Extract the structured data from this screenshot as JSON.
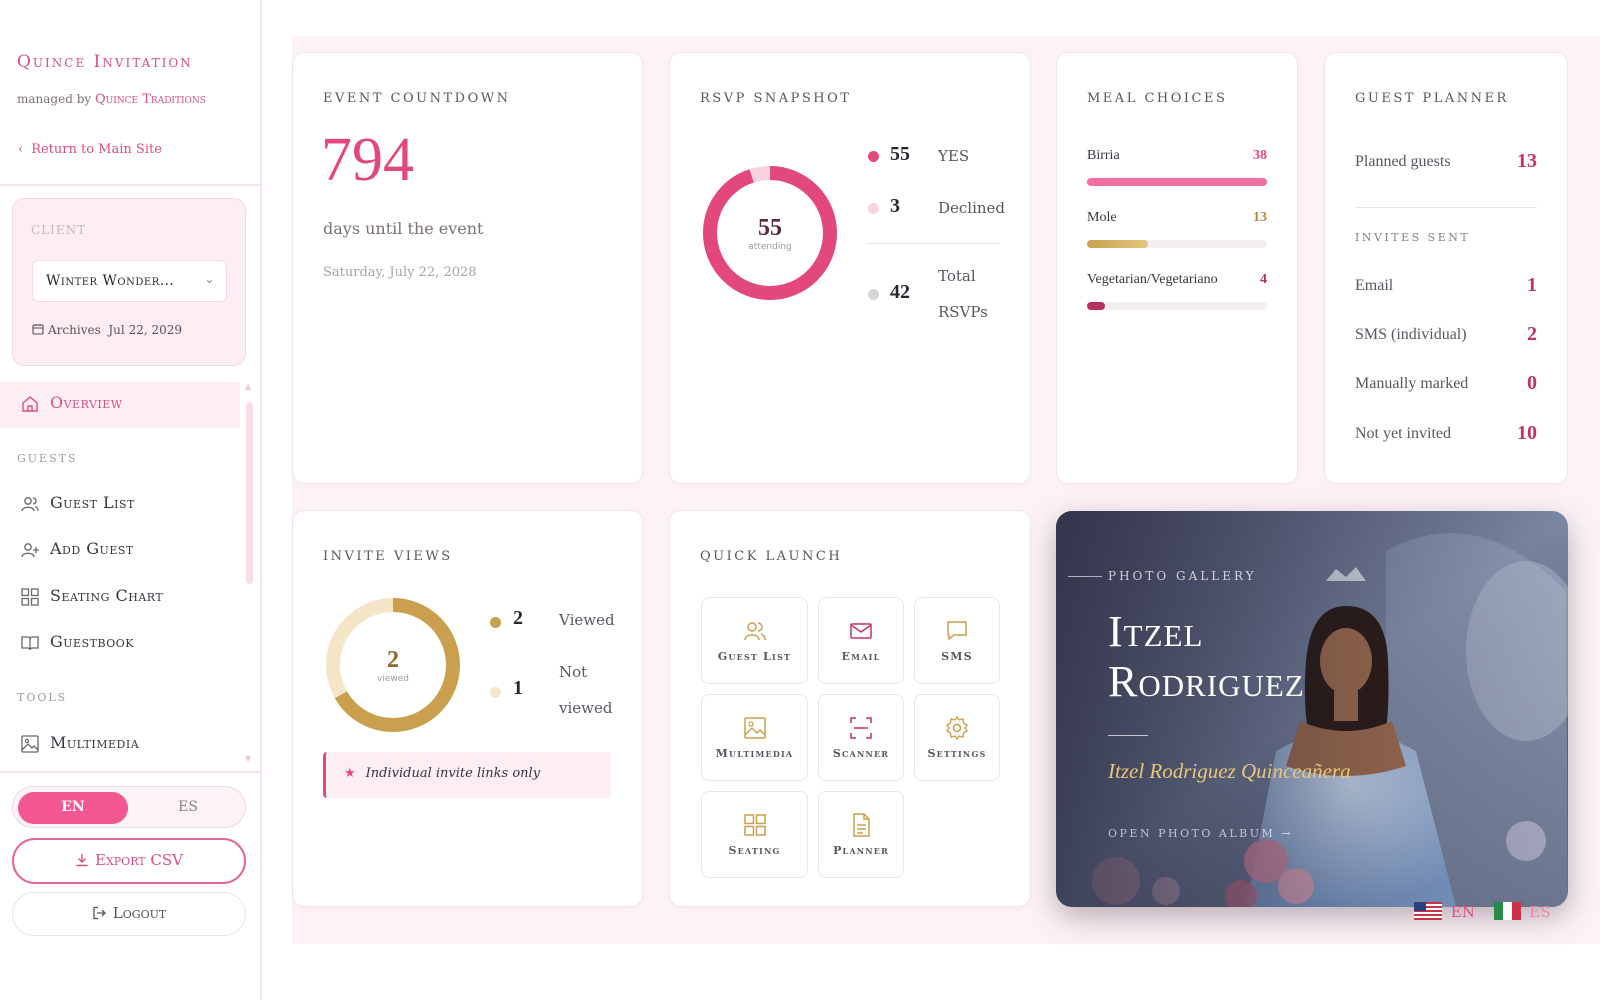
{
  "brand": {
    "title": "Quince Invitation",
    "managed_by": "managed by",
    "managed_name": "Quince Traditions",
    "return_link": "Return to Main Site"
  },
  "client": {
    "label": "CLIENT",
    "selected": "Winter Wonder…",
    "archives_label": "Archives",
    "archives_date": "Jul 22, 2029"
  },
  "nav": {
    "overview": "Overview",
    "guests_section": "GUESTS",
    "guest_list": "Guest List",
    "add_guest": "Add Guest",
    "seating_chart": "Seating Chart",
    "guestbook": "Guestbook",
    "tools_section": "TOOLS",
    "multimedia": "Multimedia"
  },
  "language": {
    "en": "EN",
    "es": "ES",
    "active": "EN"
  },
  "actions": {
    "export": "Export CSV",
    "logout": "Logout"
  },
  "countdown": {
    "title": "EVENT COUNTDOWN",
    "days": "794",
    "caption": "days until the event",
    "date": "Saturday, July 22, 2028"
  },
  "rsvp": {
    "title": "RSVP SNAPSHOT",
    "center_value": "55",
    "center_label": "attending",
    "yes_value": "55",
    "yes_label": "YES",
    "declined_value": "3",
    "declined_label": "Declined",
    "total_value": "42",
    "total_label_1": "Total",
    "total_label_2": "RSVPs",
    "ring_fraction": 0.95,
    "colors": {
      "yes": "#e2487e",
      "declined": "#f8d3de",
      "total": "#d8d4d6"
    }
  },
  "meals": {
    "title": "MEAL CHOICES",
    "items": [
      {
        "name": "Birria",
        "value": "38",
        "fraction": 1.0,
        "color": "#f2709f",
        "val_color": "#e2487e"
      },
      {
        "name": "Mole",
        "value": "13",
        "fraction": 0.34,
        "color": "#cfae5d",
        "val_color": "#b08c3a"
      },
      {
        "name": "Vegetarian/Vegetariano",
        "value": "4",
        "fraction": 0.1,
        "color": "#b1325f",
        "val_color": "#b1325f"
      }
    ]
  },
  "planner": {
    "title": "GUEST PLANNER",
    "planned_label": "Planned guests",
    "planned_value": "13",
    "invites_title": "INVITES SENT",
    "rows": [
      {
        "label": "Email",
        "value": "1"
      },
      {
        "label": "SMS (individual)",
        "value": "2"
      },
      {
        "label": "Manually marked",
        "value": "0"
      },
      {
        "label": "Not yet invited",
        "value": "10"
      }
    ]
  },
  "views": {
    "title": "INVITE VIEWS",
    "center_value": "2",
    "center_label": "viewed",
    "viewed_value": "2",
    "viewed_label": "Viewed",
    "not_viewed_value": "1",
    "not_viewed_label_1": "Not",
    "not_viewed_label_2": "viewed",
    "ring_fraction": 0.667,
    "note": "Individual invite links only",
    "colors": {
      "viewed": "#caa04e",
      "not_viewed": "#f5e6c8"
    }
  },
  "quick_launch": {
    "title": "QUICK LAUNCH",
    "tiles": [
      "Guest List",
      "Email",
      "SMS",
      "Multimedia",
      "Scanner",
      "Settings",
      "Seating",
      "Planner"
    ]
  },
  "gallery": {
    "label": "PHOTO GALLERY",
    "name_line1": "Itzel",
    "name_line2": "Rodriguez",
    "subtitle": "Itzel Rodriguez Quinceañera",
    "open": "OPEN PHOTO ALBUM →"
  },
  "footer_langs": {
    "en": "EN",
    "es": "ES"
  }
}
